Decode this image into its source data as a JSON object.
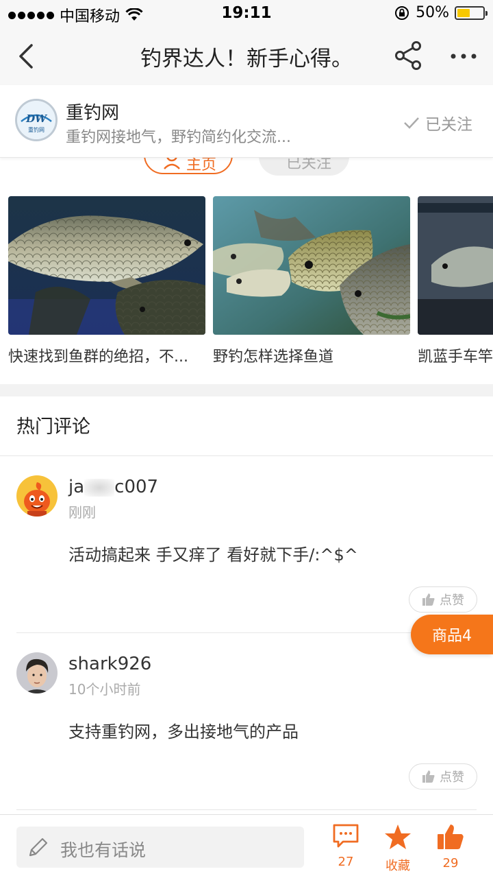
{
  "status_bar": {
    "carrier": "中国移动",
    "time": "19:11",
    "battery": "50%",
    "battery_fraction": 0.5
  },
  "nav": {
    "title": "钓界达人！新手心得。",
    "icons": {
      "back": "chevron-left-icon",
      "share": "share-icon",
      "more": "more-dots-icon"
    }
  },
  "account": {
    "name": "重钓网",
    "description": "重钓网接地气，野钓简约化交流...",
    "follow_status": "已关注",
    "logo_text": "DW",
    "logo_subtext": "重钓网"
  },
  "ghost_buttons": {
    "home": "主页",
    "follow": "已关注"
  },
  "articles": [
    {
      "caption": "快速找到鱼群的绝招，不..."
    },
    {
      "caption": "野钓怎样选择鱼道"
    },
    {
      "caption": "凯蓝手车竿"
    }
  ],
  "comments_section": {
    "title": "热门评论"
  },
  "comments": [
    {
      "user_prefix": "ja",
      "user_suffix": "c007",
      "time": "刚刚",
      "text": "活动搞起来 手又痒了 看好就下手/:^$^",
      "like_label": "点赞"
    },
    {
      "user": "shark926",
      "time": "10个小时前",
      "text": "支持重钓网，多出接地气的产品",
      "like_label": "点赞"
    }
  ],
  "products_tab": "商品4",
  "bottom_bar": {
    "reply_placeholder": "我也有话说",
    "comment_count": "27",
    "favorite_label": "收藏",
    "like_count": "29"
  },
  "colors": {
    "accent": "#f06c22",
    "products_tab": "#f5761a",
    "battery": "#f7c800"
  }
}
